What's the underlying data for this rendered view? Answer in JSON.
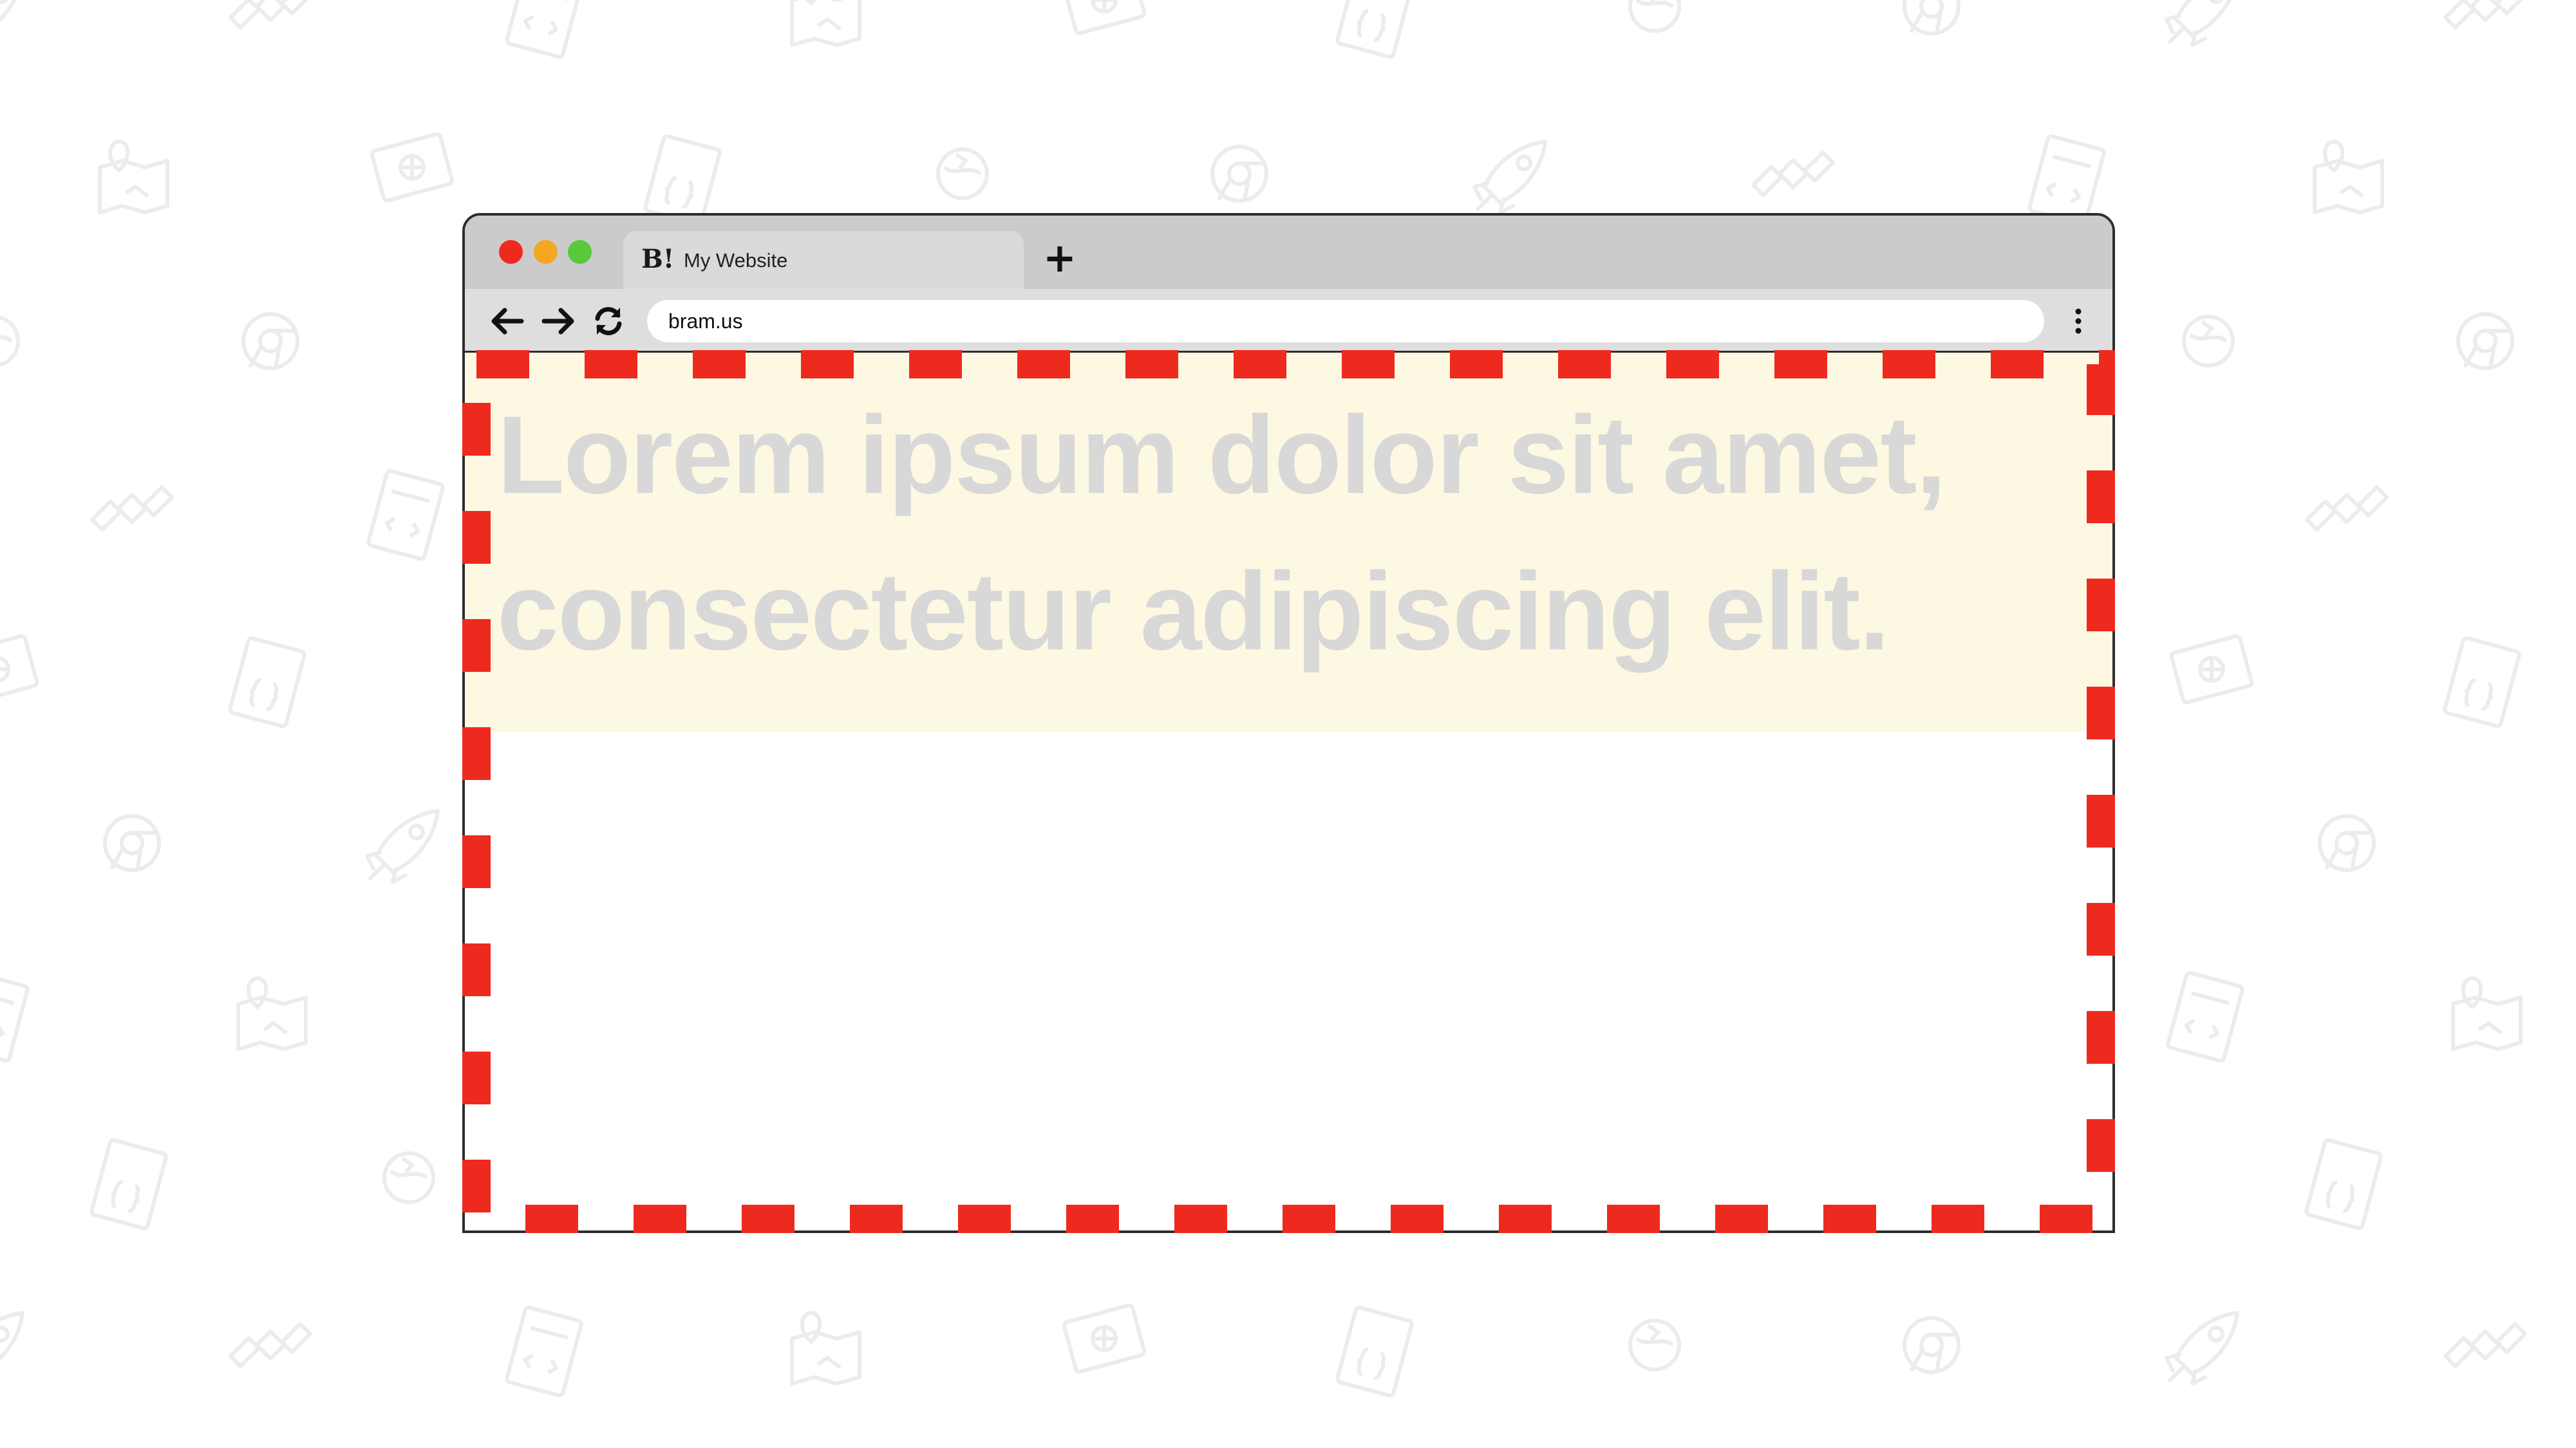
{
  "background": {
    "pattern_icon_names": [
      "rocket-icon",
      "satellite-icon",
      "html-file-icon",
      "map-pin-icon",
      "browser-globe-icon",
      "css-file-icon",
      "planet-orbit-icon",
      "chrome-logo-icon"
    ],
    "icon_color": "#ececec"
  },
  "browser": {
    "window_controls": {
      "close_color": "#ee2a1f",
      "minimize_color": "#f5a623",
      "maximize_color": "#5ac83b"
    },
    "tab": {
      "favicon": "B!",
      "title": "My Website"
    },
    "new_tab_label": "+",
    "nav": {
      "back_icon": "arrow-left-icon",
      "forward_icon": "arrow-right-icon",
      "reload_icon": "reload-icon",
      "menu_icon": "kebab-menu-icon"
    },
    "address_bar": {
      "url": "bram.us"
    }
  },
  "page": {
    "hero_text": "Lorem ipsum dolor sit amet, consectetur adipiscing elit.",
    "hero_background": "#fdf8e1",
    "hero_text_color": "#d8d8d8",
    "outline_color": "#ee2a1f",
    "outline_style": "dashed"
  }
}
